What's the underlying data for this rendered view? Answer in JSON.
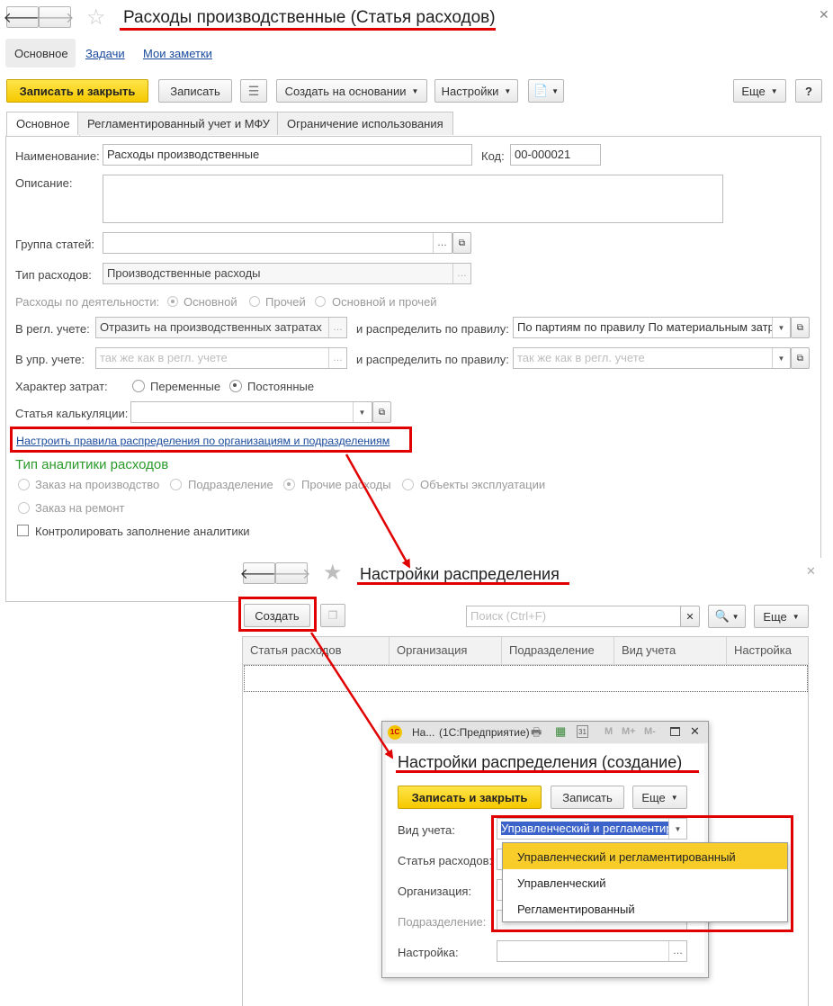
{
  "main": {
    "title": "Расходы производственные (Статья расходов)",
    "nav_tabs": [
      "Основное",
      "Задачи",
      "Мои заметки"
    ],
    "toolbar": {
      "save_close": "Записать и закрыть",
      "save": "Записать",
      "create_based": "Создать на основании",
      "settings": "Настройки",
      "more": "Еще",
      "help": "?"
    },
    "tabs": [
      "Основное",
      "Регламентированный учет и МФУ",
      "Ограничение использования"
    ],
    "form": {
      "name_label": "Наименование:",
      "name_value": "Расходы производственные",
      "code_label": "Код:",
      "code_value": "00-000021",
      "desc_label": "Описание:",
      "group_label": "Группа статей:",
      "type_label": "Тип расходов:",
      "type_value": "Производственные расходы",
      "activity_label": "Расходы по деятельности:",
      "activity_options": [
        "Основной",
        "Прочей",
        "Основной и прочей"
      ],
      "reg_label": "В регл. учете:",
      "reg_value": "Отразить на производственных затратах",
      "distribute_label": "и распределить по правилу:",
      "reg_rule_value": "По партиям по правилу По материальным затр",
      "mgmt_label": "В упр. учете:",
      "mgmt_placeholder": "так же как в регл. учете",
      "mgmt_rule_placeholder": "так же как в регл. учете",
      "cost_nature_label": "Характер затрат:",
      "cost_nature_options": [
        "Переменные",
        "Постоянные"
      ],
      "calc_label": "Статья калькуляции:",
      "rules_link": "Настроить правила распределения по организациям и подразделениям",
      "analytics_title": "Тип аналитики расходов",
      "analytics_options": [
        "Заказ на производство",
        "Подразделение",
        "Прочие расходы",
        "Объекты эксплуатации",
        "Заказ на ремонт"
      ],
      "control_checkbox": "Контролировать заполнение аналитики"
    }
  },
  "dist": {
    "title": "Настройки распределения",
    "create": "Создать",
    "search_placeholder": "Поиск (Ctrl+F)",
    "more": "Еще",
    "columns": [
      "Статья расходов",
      "Организация",
      "Подразделение",
      "Вид учета",
      "Настройка"
    ]
  },
  "dialog": {
    "window_title": "На...",
    "app_name": "(1С:Предприятие)",
    "logo": "1С",
    "title_buttons": [
      "M",
      "M+",
      "M-"
    ],
    "heading": "Настройки распределения (создание)",
    "save_close": "Записать и закрыть",
    "save": "Записать",
    "more": "Еще",
    "fields": {
      "view_label": "Вид учета:",
      "view_value": "Управленческий и регламентир",
      "article_label": "Статья расходов:",
      "org_label": "Организация:",
      "dept_label": "Подразделение:",
      "setting_label": "Настройка:"
    },
    "dropdown_options": [
      "Управленческий и регламентированный",
      "Управленческий",
      "Регламентированный"
    ]
  },
  "colors": {
    "accent_yellow": "#f6c800",
    "annotation_red": "#e10000",
    "group_green": "#2a9a2a",
    "link_blue": "#1a4a9c"
  }
}
